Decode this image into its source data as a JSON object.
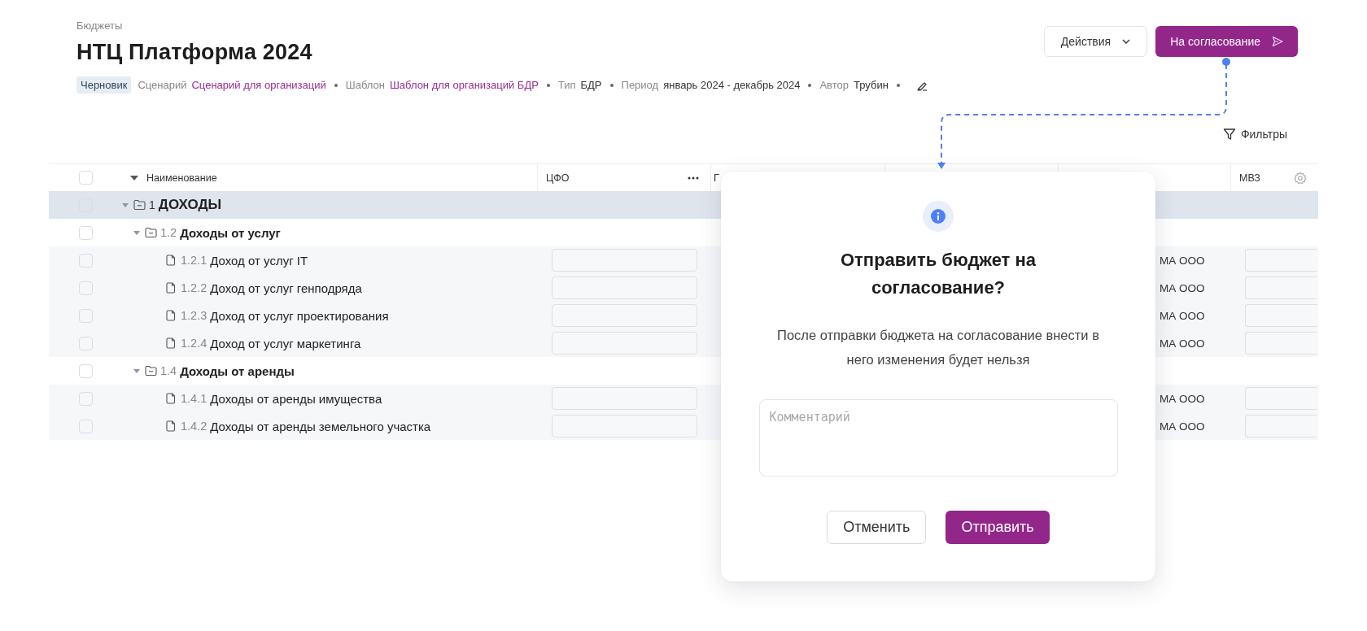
{
  "breadcrumb": "Бюджеты",
  "title": "НТЦ Платформа 2024",
  "status_badge": "Черновик",
  "meta": [
    {
      "label": "Сценарий",
      "value": "Сценарий для организаций",
      "kind": "link"
    },
    {
      "label": "Шаблон",
      "value": "Шаблон для организаций БДР",
      "kind": "link"
    },
    {
      "label": "Тип",
      "value": "БДР",
      "kind": "text"
    },
    {
      "label": "Период",
      "value": "январь 2024 - декабрь 2024",
      "kind": "text"
    },
    {
      "label": "Автор",
      "value": "Трубин",
      "kind": "text"
    }
  ],
  "actions": {
    "menu": "Действия",
    "submit": "На согласование"
  },
  "filters": "Фильтры",
  "table": {
    "header_checked": false,
    "columns": [
      {
        "label": "Наименование",
        "kind": "name"
      },
      {
        "label": "ЦФО",
        "kind": "field"
      },
      {
        "label": "Г",
        "kind": "blank"
      },
      {
        "kind": "blank"
      },
      {
        "kind": "text"
      },
      {
        "label": "МВЗ",
        "kind": "field"
      }
    ],
    "rows": [
      {
        "number": "1",
        "name": "ДОХОДЫ",
        "kind": "section",
        "checked": false,
        "expanded": true,
        "children": [
          {
            "number": "1.2",
            "name": "Доходы от услуг",
            "kind": "group",
            "checked": false,
            "expanded": true,
            "children": [
              {
                "number": "1.2.1",
                "name": "Доход от услуг IT",
                "kind": "item",
                "checked": false,
                "column_5": "МА ООО"
              },
              {
                "number": "1.2.2",
                "name": "Доход от услуг генподряда",
                "kind": "item",
                "checked": false,
                "column_5": "МА ООО"
              },
              {
                "number": "1.2.3",
                "name": "Доход от услуг проектирования",
                "kind": "item",
                "checked": false,
                "column_5": "МА ООО"
              },
              {
                "number": "1.2.4",
                "name": "Доход от услуг маркетинга",
                "kind": "item",
                "checked": false,
                "column_5": "МА ООО"
              }
            ]
          },
          {
            "number": "1.4",
            "name": "Доходы от аренды",
            "kind": "group",
            "checked": false,
            "expanded": true,
            "children": [
              {
                "number": "1.4.1",
                "name": "Доходы от аренды имущества",
                "kind": "item",
                "checked": false,
                "column_5": "МА ООО"
              },
              {
                "number": "1.4.2",
                "name": "Доходы от аренды земельного участка",
                "kind": "item",
                "checked": false,
                "column_5": "МА ООО"
              }
            ]
          }
        ]
      }
    ]
  },
  "dialog": {
    "title": "Отправить бюджет на согласование?",
    "message": "После отправки бюджета на согласование внести в него изменения будет нельзя",
    "comment": {
      "placeholder": "Комментарий"
    },
    "buttons": [
      {
        "label": "Отменить",
        "kind": "secondary"
      },
      {
        "label": "Отправить",
        "kind": "primary"
      }
    ]
  }
}
